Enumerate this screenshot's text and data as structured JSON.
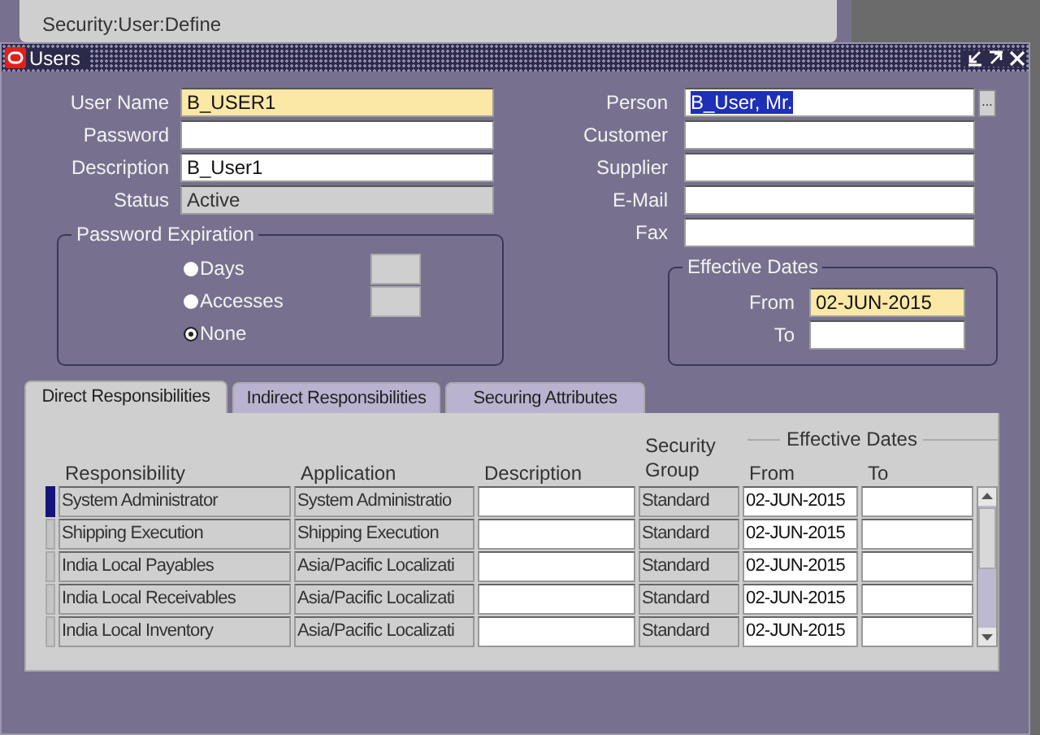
{
  "background_window": {
    "title": "Security:User:Define"
  },
  "window": {
    "title": "Users"
  },
  "user_fields": [
    {
      "label": "User Name",
      "value": "B_USER1",
      "kind": "required"
    },
    {
      "label": "Password",
      "kind": "text"
    },
    {
      "label": "Description",
      "value": "B_User1",
      "kind": "text"
    },
    {
      "label": "Status",
      "value": "Active",
      "kind": "readonly"
    }
  ],
  "password_expiration": {
    "title": "Password Expiration",
    "options": [
      {
        "label": "Days",
        "selected": false,
        "kind": "with-field"
      },
      {
        "label": "Accesses",
        "selected": false,
        "kind": "with-field"
      },
      {
        "label": "None",
        "selected": true,
        "kind": "plain"
      }
    ]
  },
  "person_fields": [
    {
      "label": "Person",
      "value": "B_User, Mr.",
      "kind": "lov",
      "highlighted": true,
      "button": "..."
    },
    {
      "label": "Customer",
      "kind": "text"
    },
    {
      "label": "Supplier",
      "kind": "text"
    },
    {
      "label": "E-Mail",
      "kind": "text"
    },
    {
      "label": "Fax",
      "kind": "text"
    }
  ],
  "effective_dates": {
    "title": "Effective Dates",
    "fields": [
      {
        "label": "From",
        "value": "02-JUN-2015",
        "kind": "required"
      },
      {
        "label": "To",
        "kind": "text"
      }
    ]
  },
  "tabs": [
    {
      "label": "Direct Responsibilities",
      "selected": true
    },
    {
      "label": "Indirect Responsibilities",
      "selected": false
    },
    {
      "label": "Securing Attributes",
      "selected": false
    }
  ],
  "table": {
    "group_heading": "Effective Dates",
    "columns": [
      {
        "label": "Responsibility",
        "kind": "readonly"
      },
      {
        "label": "Application",
        "kind": "readonly"
      },
      {
        "label": "Description",
        "kind": "text"
      },
      {
        "label": "Security Group",
        "kind": "readonly"
      },
      {
        "label": "From",
        "kind": "text"
      },
      {
        "label": "To",
        "kind": "text"
      }
    ],
    "rows": [
      {
        "selected": true,
        "cells": [
          "System Administrator",
          "System Administratio",
          null,
          "Standard",
          "02-JUN-2015",
          null
        ]
      },
      {
        "selected": false,
        "cells": [
          "Shipping Execution",
          "Shipping Execution",
          null,
          "Standard",
          "02-JUN-2015",
          null
        ]
      },
      {
        "selected": false,
        "cells": [
          "India Local Payables",
          "Asia/Pacific Localizati",
          null,
          "Standard",
          "02-JUN-2015",
          null
        ]
      },
      {
        "selected": false,
        "cells": [
          "India Local Receivables",
          "Asia/Pacific Localizati",
          null,
          "Standard",
          "02-JUN-2015",
          null
        ]
      },
      {
        "selected": false,
        "cells": [
          "India Local Inventory",
          "Asia/Pacific Localizati",
          null,
          "Standard",
          "02-JUN-2015",
          null
        ]
      }
    ]
  }
}
